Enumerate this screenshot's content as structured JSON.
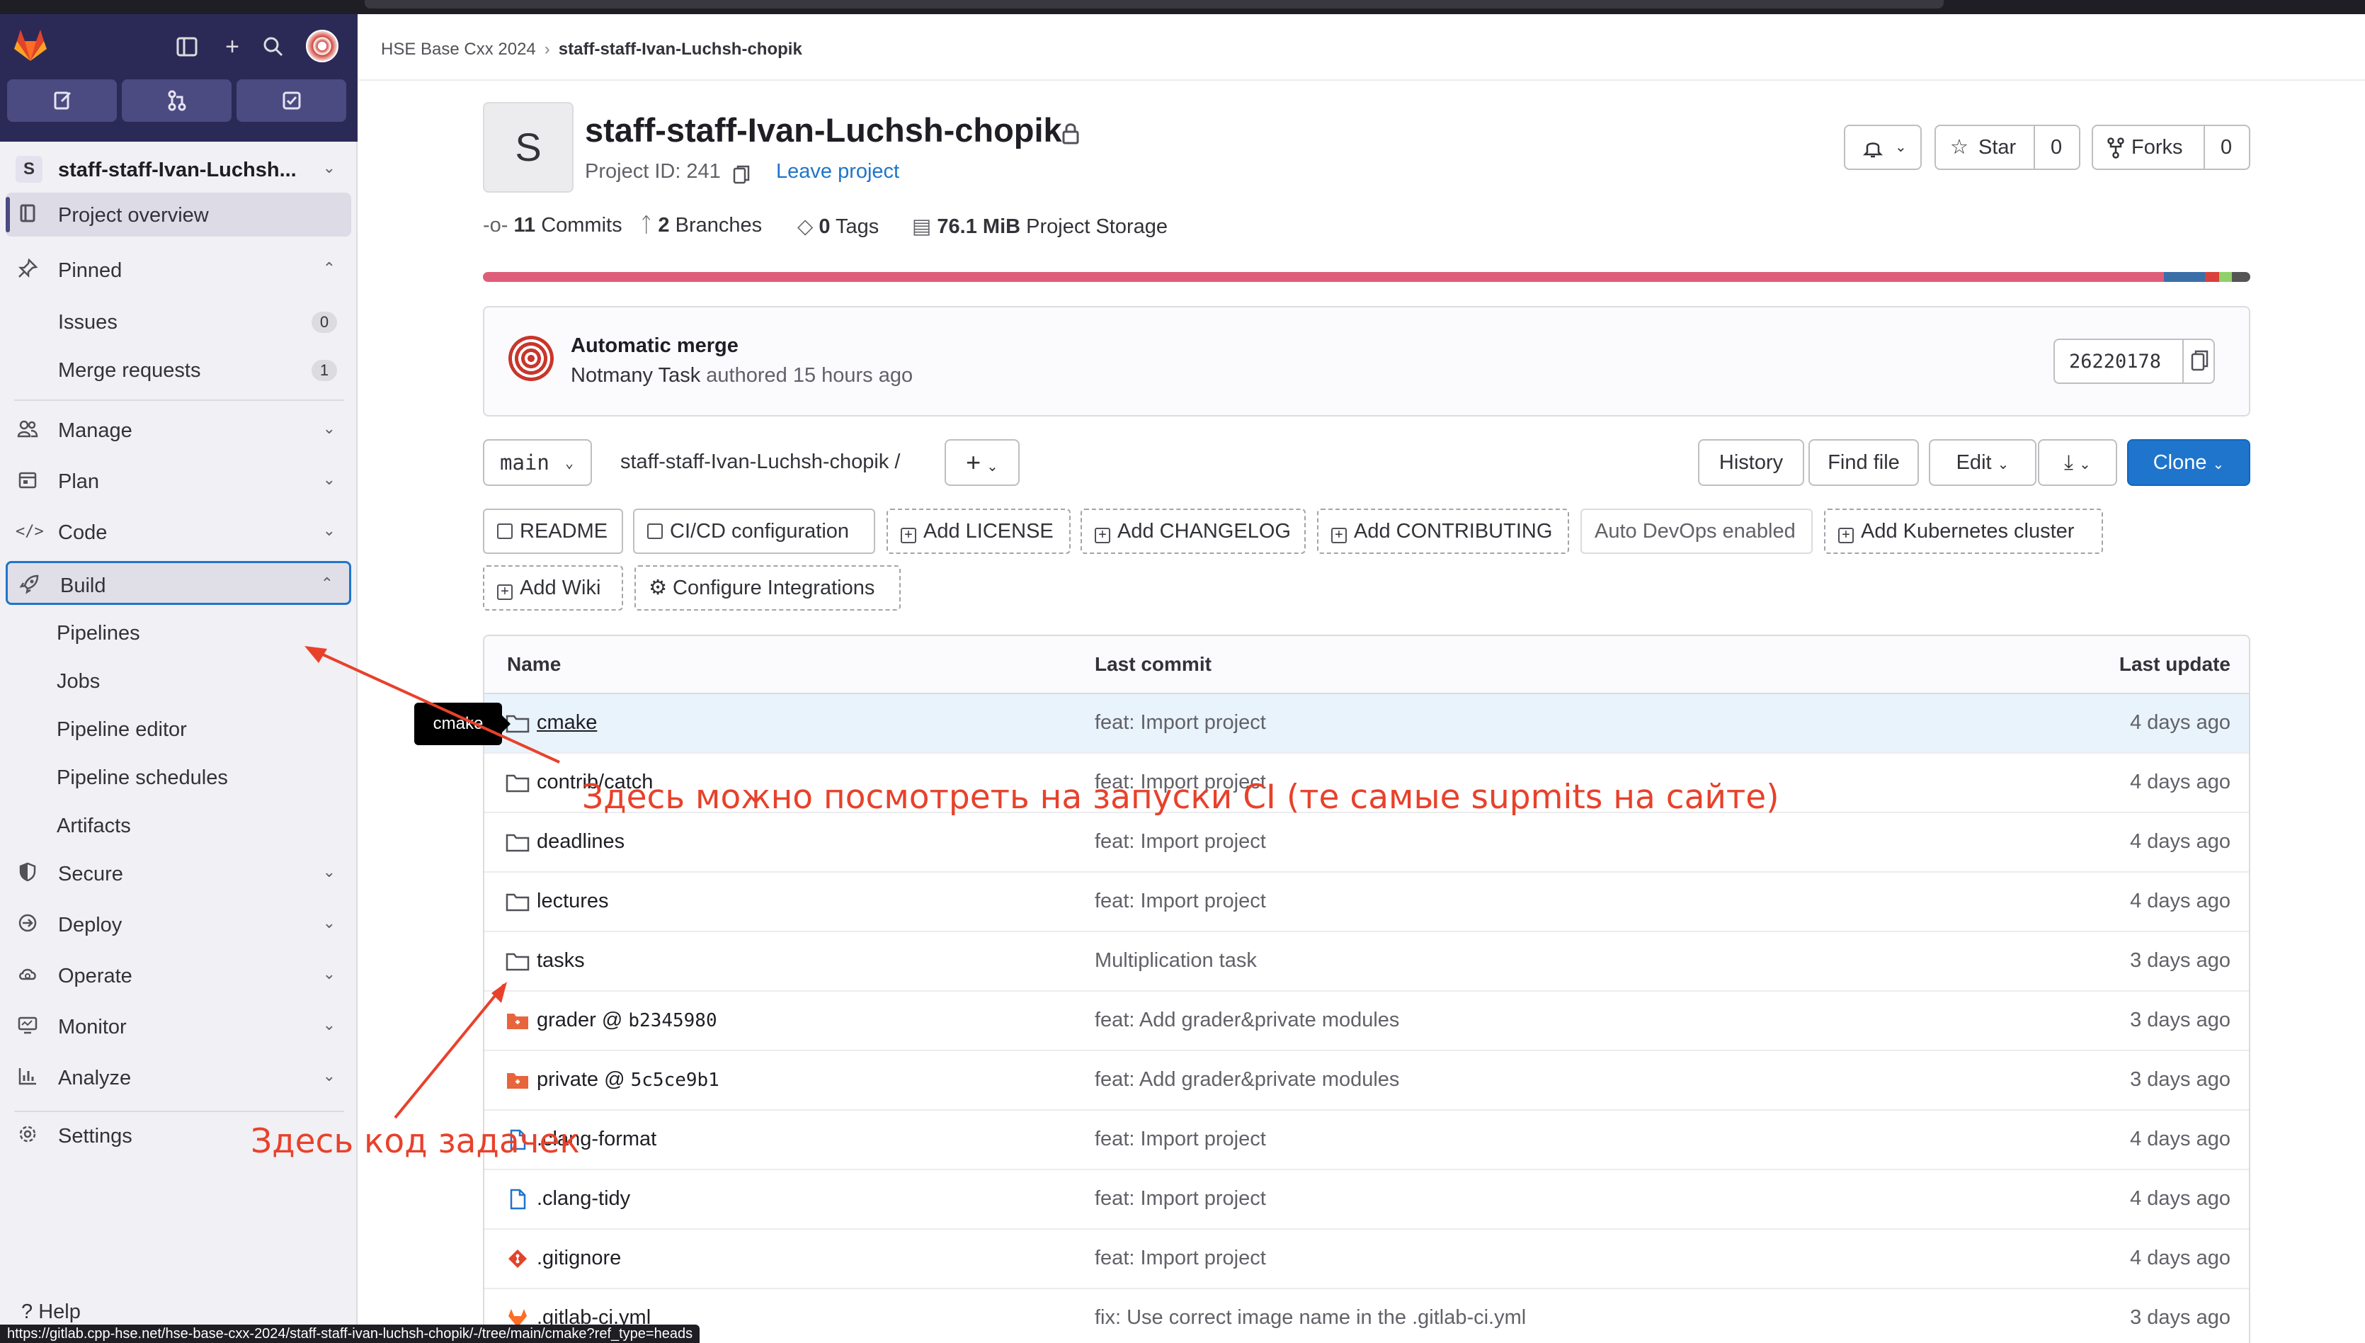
{
  "sidebar": {
    "project_badge": "S",
    "project_name": "staff-staff-Ivan-Luchsh...",
    "items": {
      "overview": "Project overview",
      "pinned": "Pinned",
      "issues": "Issues",
      "issues_count": "0",
      "merge_requests": "Merge requests",
      "merge_requests_count": "1",
      "manage": "Manage",
      "plan": "Plan",
      "code": "Code",
      "build": "Build",
      "pipelines": "Pipelines",
      "jobs": "Jobs",
      "pipeline_editor": "Pipeline editor",
      "pipeline_schedules": "Pipeline schedules",
      "artifacts": "Artifacts",
      "secure": "Secure",
      "deploy": "Deploy",
      "operate": "Operate",
      "monitor": "Monitor",
      "analyze": "Analyze",
      "settings": "Settings",
      "help": "Help"
    }
  },
  "breadcrumb": {
    "group": "HSE Base Cxx 2024",
    "current": "staff-staff-Ivan-Luchsh-chopik"
  },
  "project": {
    "avatar_letter": "S",
    "title": "staff-staff-Ivan-Luchsh-chopik",
    "project_id": "Project ID: 241",
    "leave": "Leave project",
    "star_label": "Star",
    "star_count": "0",
    "forks_label": "Forks",
    "forks_count": "0"
  },
  "stats": {
    "commits_n": "11",
    "commits_label": "Commits",
    "branches_n": "2",
    "branches_label": "Branches",
    "tags_n": "0",
    "tags_label": "Tags",
    "storage_n": "76.1 MiB",
    "storage_label": "Project Storage"
  },
  "language_bar_colors": [
    "#e05d79",
    "#3b6fa8",
    "#d9413a",
    "#8fd16a",
    "#555555"
  ],
  "last_commit": {
    "title": "Automatic merge",
    "author": "Notmany Task",
    "meta": "authored 15 hours ago",
    "sha": "26220178"
  },
  "toolbar": {
    "branch": "main",
    "path": "staff-staff-Ivan-Luchsh-chopik",
    "path_sep": "/",
    "history": "History",
    "find_file": "Find file",
    "edit": "Edit",
    "clone": "Clone"
  },
  "quick_actions": {
    "readme": "README",
    "cicd": "CI/CD configuration",
    "license": "Add LICENSE",
    "changelog": "Add CHANGELOG",
    "contributing": "Add CONTRIBUTING",
    "autodevops": "Auto DevOps enabled",
    "kubernetes": "Add Kubernetes cluster",
    "wiki": "Add Wiki",
    "integrations": "Configure Integrations"
  },
  "file_table": {
    "headers": {
      "name": "Name",
      "last_commit": "Last commit",
      "last_update": "Last update"
    },
    "rows": [
      {
        "name": "cmake",
        "type": "folder",
        "commit": "feat: Import project",
        "updated": "4 days ago"
      },
      {
        "name": "contrib/catch",
        "type": "folder",
        "commit": "feat: Import project",
        "updated": "4 days ago"
      },
      {
        "name": "deadlines",
        "type": "folder",
        "commit": "feat: Import project",
        "updated": "4 days ago"
      },
      {
        "name": "lectures",
        "type": "folder",
        "commit": "feat: Import project",
        "updated": "4 days ago"
      },
      {
        "name": "tasks",
        "type": "folder",
        "commit": "Multiplication task",
        "updated": "3 days ago"
      },
      {
        "name": "grader @ ",
        "ref": "b2345980",
        "type": "submodule",
        "commit": "feat: Add grader&private modules",
        "updated": "3 days ago"
      },
      {
        "name": "private @ ",
        "ref": "5c5ce9b1",
        "type": "submodule",
        "commit": "feat: Add grader&private modules",
        "updated": "3 days ago"
      },
      {
        "name": ".clang-format",
        "type": "file",
        "commit": "feat: Import project",
        "updated": "4 days ago"
      },
      {
        "name": ".clang-tidy",
        "type": "file",
        "commit": "feat: Import project",
        "updated": "4 days ago"
      },
      {
        "name": ".gitignore",
        "type": "git",
        "commit": "feat: Import project",
        "updated": "4 days ago"
      },
      {
        "name": ".gitlab-ci.yml",
        "type": "gitlab",
        "commit": "fix: Use correct image name in the .gitlab-ci.yml",
        "updated": "3 days ago"
      }
    ]
  },
  "tooltip": "cmake",
  "annotations": {
    "ci_note": "Здесь можно посмотреть на запуски CI (те самые supmits на сайте)",
    "tasks_note": "Здесь код задачек"
  },
  "status_url": "https://gitlab.cpp-hse.net/hse-base-cxx-2024/staff-staff-ivan-luchsh-chopik/-/tree/main/cmake?ref_type=heads"
}
